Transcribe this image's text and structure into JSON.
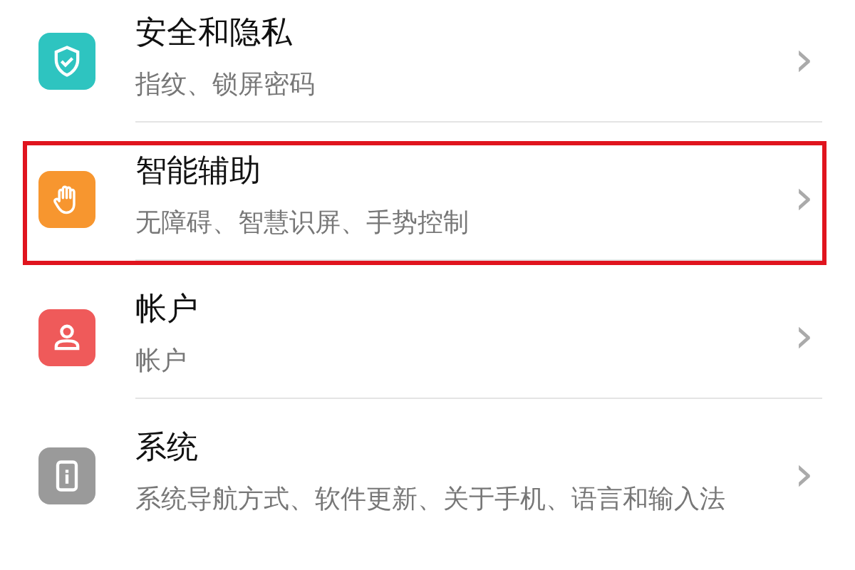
{
  "settings": [
    {
      "kind": "shield",
      "color": "#2ec4c0",
      "title": "安全和隐私",
      "subtitle": "指纹、锁屏密码",
      "chevron": "›",
      "highlighted": false
    },
    {
      "kind": "hand",
      "color": "#f7962f",
      "title": "智能辅助",
      "subtitle": "无障碍、智慧识屏、手势控制",
      "chevron": "›",
      "highlighted": true
    },
    {
      "kind": "person",
      "color": "#ef5a5a",
      "title": "帐户",
      "subtitle": "帐户",
      "chevron": "›",
      "highlighted": false
    },
    {
      "kind": "info",
      "color": "#9a9a9a",
      "title": "系统",
      "subtitle": "系统导航方式、软件更新、关于手机、语言和输入法",
      "chevron": "›",
      "highlighted": false
    }
  ]
}
